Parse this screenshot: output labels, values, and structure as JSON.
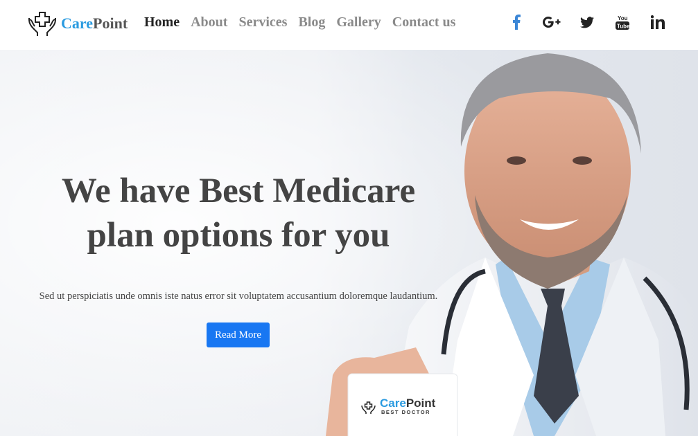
{
  "brand": {
    "name_part1": "Care",
    "name_part2": "Point",
    "icon": "hands-cross-icon"
  },
  "nav": {
    "items": [
      {
        "label": "Home",
        "active": true
      },
      {
        "label": "About",
        "active": false
      },
      {
        "label": "Services",
        "active": false
      },
      {
        "label": "Blog",
        "active": false
      },
      {
        "label": "Gallery",
        "active": false
      },
      {
        "label": "Contact us",
        "active": false
      }
    ]
  },
  "social": {
    "items": [
      {
        "icon": "facebook-icon",
        "color": "#3b86d6"
      },
      {
        "icon": "google-plus-icon",
        "color": "#222222"
      },
      {
        "icon": "twitter-icon",
        "color": "#222222"
      },
      {
        "icon": "youtube-icon",
        "color": "#222222"
      },
      {
        "icon": "linkedin-icon",
        "color": "#222222"
      }
    ]
  },
  "hero": {
    "headline_line1": "We have Best Medicare",
    "headline_line2": "plan options for you",
    "subtext": "Sed ut perspiciatis unde omnis iste natus error sit voluptatem accusantium doloremque laudantium.",
    "button_label": "Read More",
    "card_brand_part1": "Care",
    "card_brand_part2": "Point",
    "card_tagline": "BEST DOCTOR"
  },
  "colors": {
    "accent": "#2b9be0",
    "button": "#1877f2",
    "heading": "#444444"
  }
}
